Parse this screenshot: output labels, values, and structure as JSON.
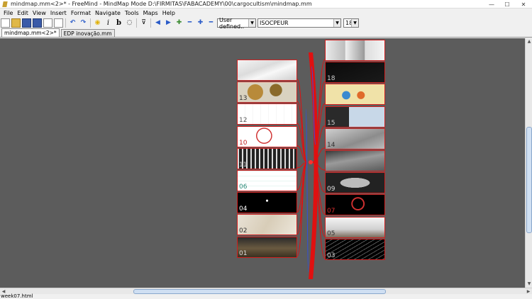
{
  "window": {
    "title": "mindmap.mm<2>* - FreeMind - MindMap Mode D:\\FIRMITAS\\FABACADEMY\\00\\cargocultism\\mindmap.mm",
    "minimize_glyph": "—",
    "maximize_glyph": "☐",
    "close_glyph": "✕"
  },
  "menu": [
    "File",
    "Edit",
    "View",
    "Insert",
    "Format",
    "Navigate",
    "Tools",
    "Maps",
    "Help"
  ],
  "toolbar": {
    "view_select": "User defined..",
    "font_select": "ISOCPEUR",
    "size_select": "18"
  },
  "tabs": [
    {
      "label": "mindmap.mm<2>*",
      "active": true
    },
    {
      "label": "EDP inovação.mm",
      "active": false
    }
  ],
  "status": "week07.html",
  "map": {
    "left_nodes": [
      {
        "label": "",
        "theme": "paper"
      },
      {
        "label": "13",
        "theme": "pcb"
      },
      {
        "label": "12",
        "theme": "schematic"
      },
      {
        "label": "10",
        "theme": "redtrace"
      },
      {
        "label": "11",
        "theme": "darkstripes"
      },
      {
        "label": "06",
        "theme": "eagle"
      },
      {
        "label": "04",
        "theme": "blackboard"
      },
      {
        "label": "02",
        "theme": "sketch"
      },
      {
        "label": "01",
        "theme": "photo"
      }
    ],
    "right_nodes": [
      {
        "label": "",
        "theme": "collage"
      },
      {
        "label": "18",
        "theme": "darkline"
      },
      {
        "label": "",
        "theme": "poster"
      },
      {
        "label": "15",
        "theme": "screens"
      },
      {
        "label": "14",
        "theme": "model"
      },
      {
        "label": "",
        "theme": "terrain"
      },
      {
        "label": "09",
        "theme": "mesh"
      },
      {
        "label": "07",
        "theme": "redwire"
      },
      {
        "label": "05",
        "theme": "building"
      },
      {
        "label": "03",
        "theme": "wireframe"
      }
    ]
  },
  "colors": {
    "canvas": "#5c5c5c",
    "edge": "#e01010",
    "edge_blue": "#3050e0",
    "border": "#d02020"
  }
}
